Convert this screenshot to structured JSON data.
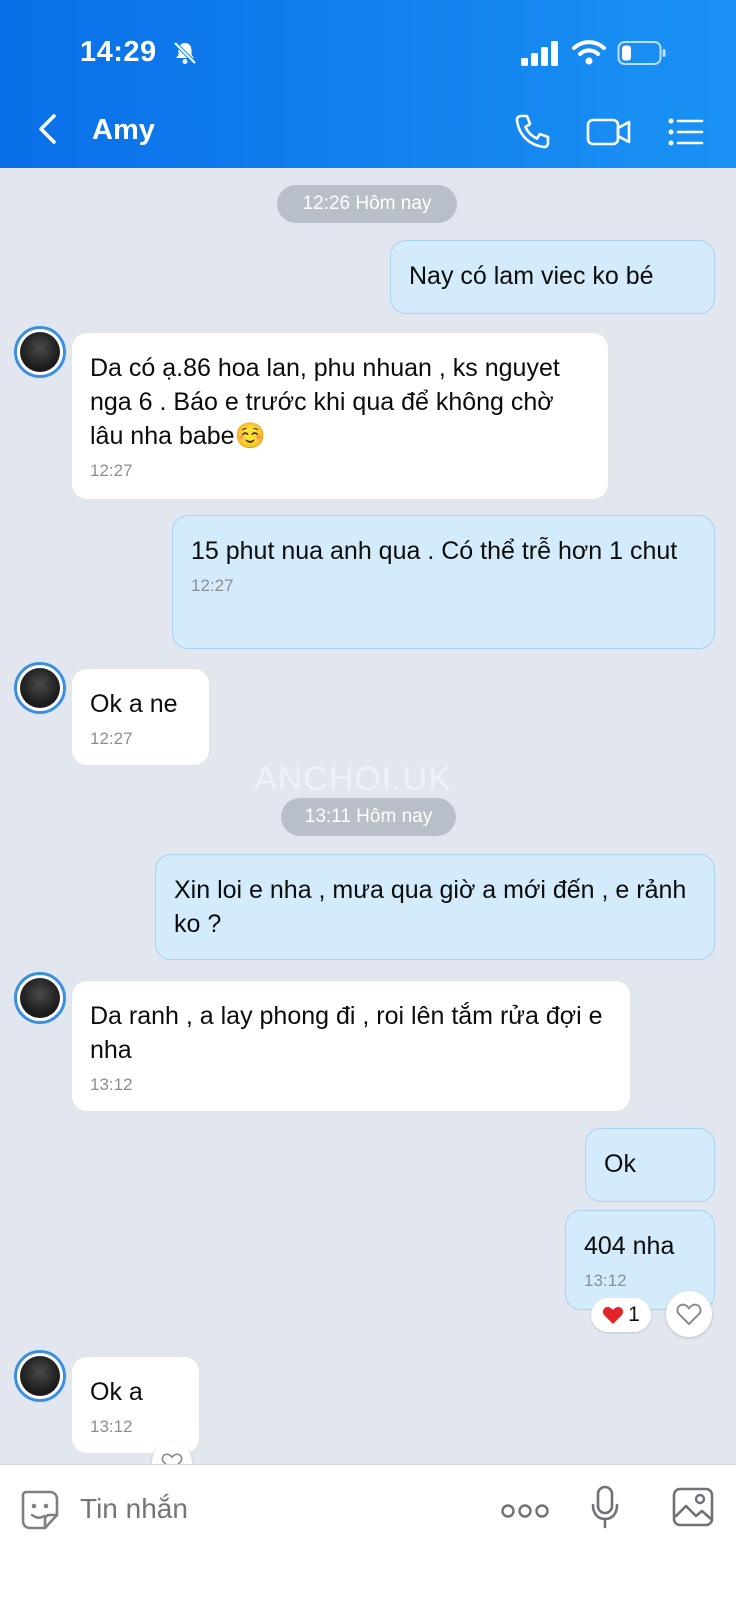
{
  "status_bar": {
    "time": "14:29"
  },
  "header": {
    "title": "Amy"
  },
  "messages": {
    "ts1": "12:26 Hôm nay",
    "m1": {
      "text": "Nay có lam viec ko bé"
    },
    "m2": {
      "text": "Da có ạ.86 hoa lan, phu nhuan , ks nguyet nga 6 . Báo e trước khi qua để không chờ lâu nha babe☺️",
      "time": "12:27"
    },
    "m3": {
      "text": "15 phut nua anh qua . Có thể trễ hơn 1 chut",
      "time": "12:27"
    },
    "m4": {
      "text": "Ok a ne",
      "time": "12:27"
    },
    "ts2": "13:11 Hôm nay",
    "m5": {
      "text": "Xin loi e nha , mưa qua giờ a mới đến , e rảnh ko ?"
    },
    "m6": {
      "text": "Da ranh , a lay phong đi , roi lên tắm rửa đợi e nha",
      "time": "13:12"
    },
    "m7": {
      "text": "Ok"
    },
    "m8": {
      "text": "404 nha",
      "time": "13:12",
      "reaction_count": "1"
    },
    "m9": {
      "text": "Ok a",
      "time": "13:12"
    }
  },
  "watermark": "ANCHOI.UK",
  "composer": {
    "placeholder": "Tin nhắn"
  },
  "colors": {
    "header_start": "#0a6fe8",
    "header_end": "#1a92f4",
    "outgoing_bubble": "#d3ebfb",
    "incoming_bubble": "#ffffff",
    "background": "#e2e6ee"
  },
  "icons": [
    "back-icon",
    "phone-icon",
    "video-icon",
    "menu-icon",
    "sticker-icon",
    "more-icon",
    "microphone-icon",
    "image-icon",
    "heart-icon"
  ]
}
